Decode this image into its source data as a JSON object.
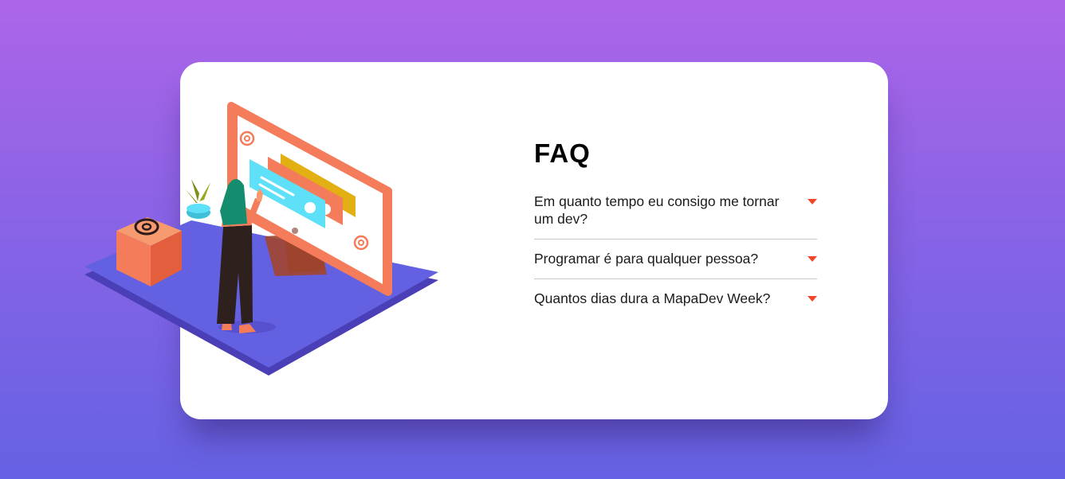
{
  "faq": {
    "title": "FAQ",
    "items": [
      {
        "question": "Em quanto tempo eu consigo me tornar um dev?",
        "expanded": false
      },
      {
        "question": "Programar é para qualquer pessoa?",
        "expanded": false
      },
      {
        "question": "Quantos dias dura a MapaDev Week?",
        "expanded": false
      }
    ],
    "toggle_icon": "caret-down-icon"
  },
  "illustration": {
    "subject": "woman-at-monitor-illustration",
    "colors": {
      "platform": "#6361e2",
      "monitor": "#f47c5a",
      "accent": "#f0452a",
      "card_blue": "#5de0f8",
      "card_yellow": "#e3b014"
    }
  },
  "theme": {
    "background_top": "#ad65e9",
    "background_bottom": "#6562e3",
    "card_background": "#ffffff",
    "caret_color": "#f0452a"
  }
}
